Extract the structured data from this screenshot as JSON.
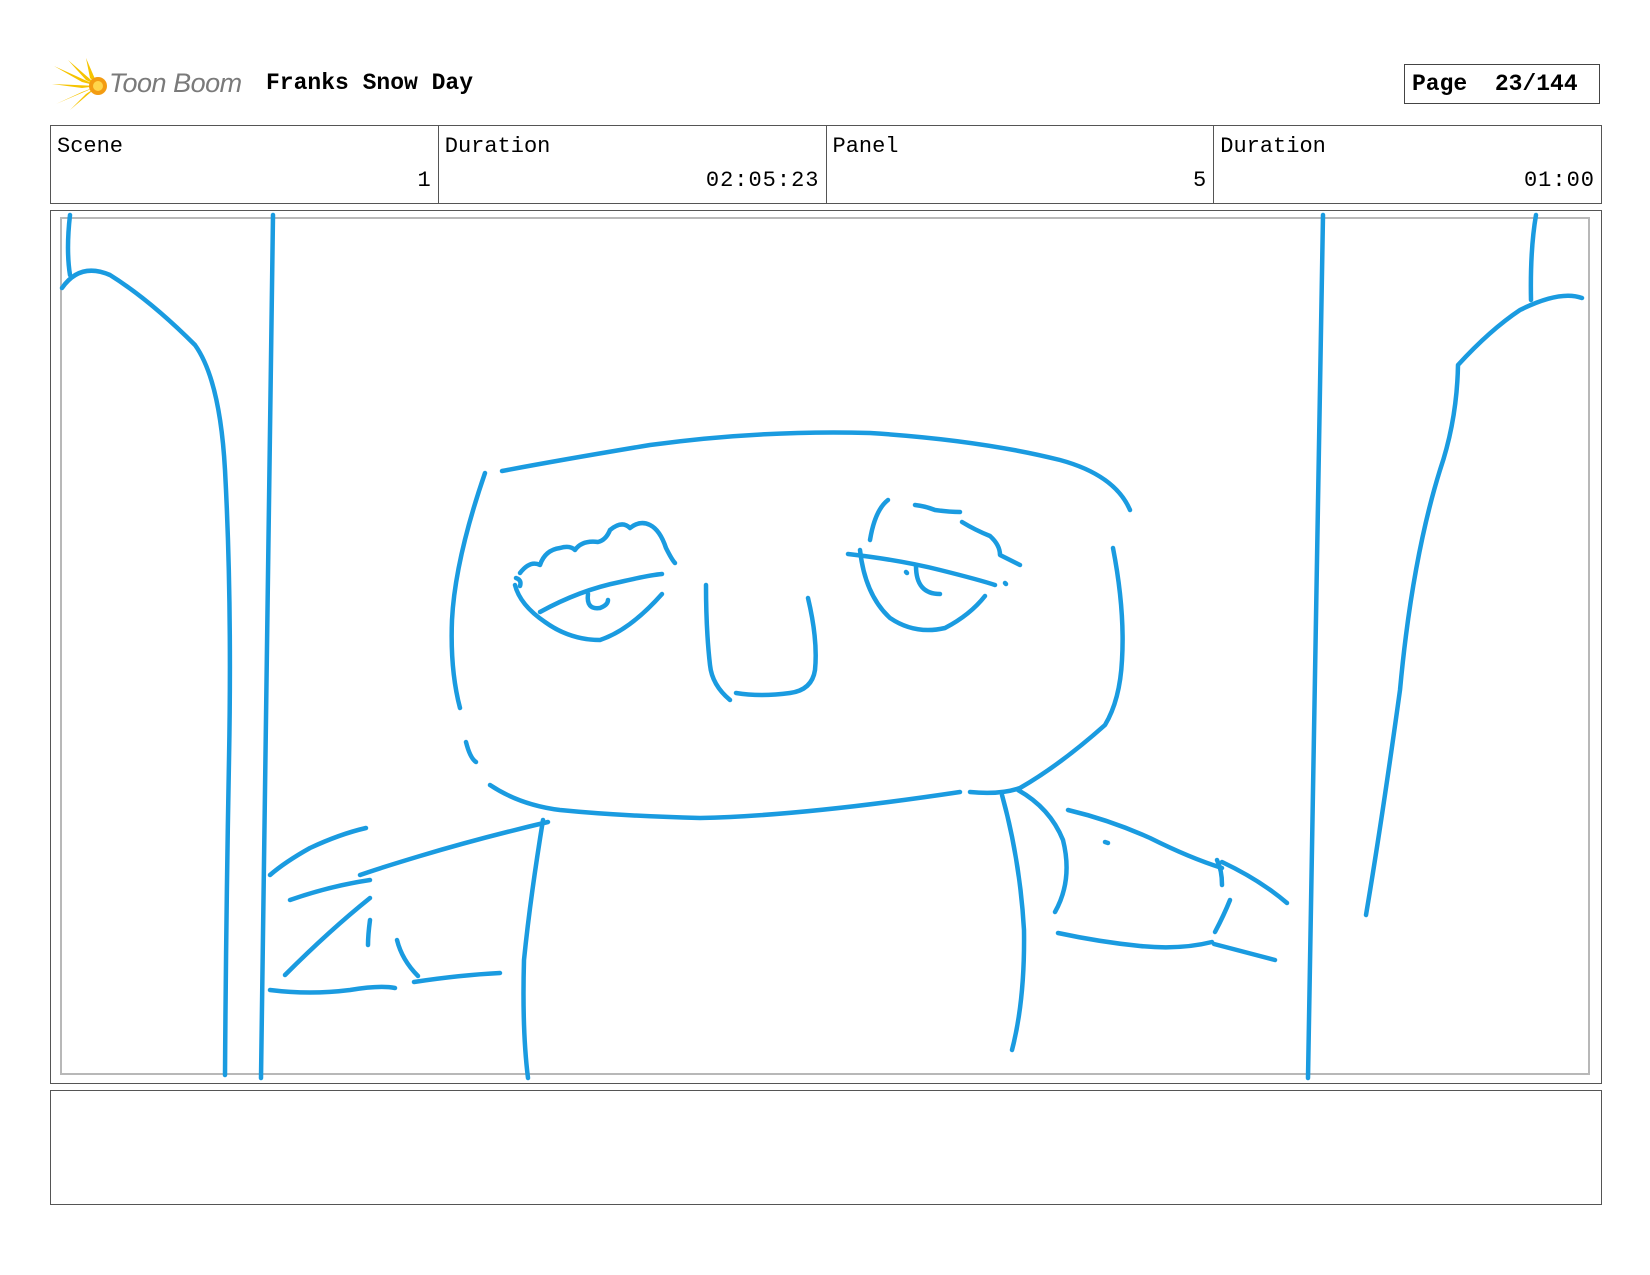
{
  "logo": {
    "brand_text": "Toon Boom",
    "icon": "toon-boom-starburst-icon",
    "icon_colors": [
      "#f6c400",
      "#f39c12"
    ]
  },
  "header": {
    "project_title": "Franks Snow Day",
    "page_label": "Page",
    "page_number": "23/144"
  },
  "info": {
    "scene_label": "Scene",
    "scene_value": "1",
    "scene_duration_label": "Duration",
    "scene_duration_value": "02:05:23",
    "panel_label": "Panel",
    "panel_value": "5",
    "panel_duration_label": "Duration",
    "panel_duration_value": "01:00"
  },
  "sketch": {
    "stroke_color": "#1a9be0"
  },
  "notes": {
    "text": ""
  }
}
